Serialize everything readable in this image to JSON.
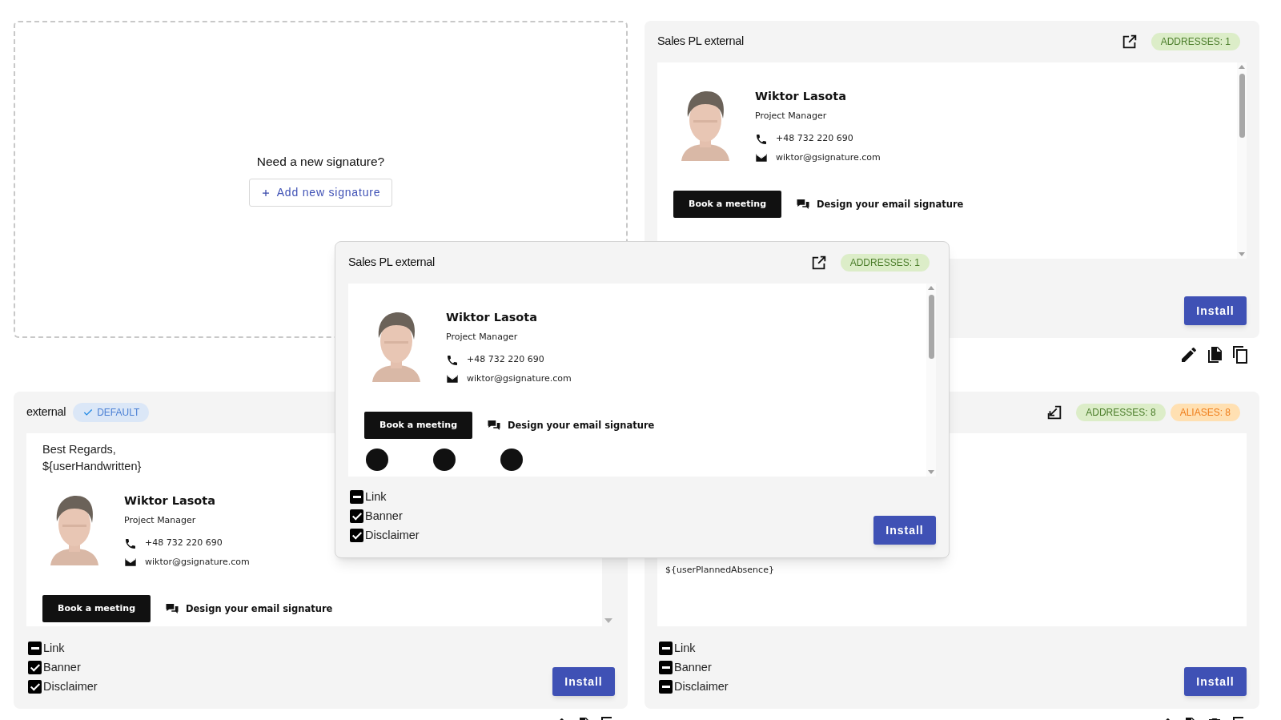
{
  "new_signature_card": {
    "prompt": "Need a new signature?",
    "button": "Add new signature"
  },
  "cards": [
    {
      "title": "Sales PL external",
      "badges": [
        {
          "text": "ADDRESSES: 1",
          "color": "#dcedc8"
        }
      ],
      "preview": {
        "kind": "signature",
        "name": "Wiktor Lasota",
        "role": "Project Manager",
        "phone": "+48 732 220 690",
        "email": "wiktor@gsignature.com",
        "meeting_button": "Book a meeting",
        "design_link": "Design your email signature"
      },
      "install": "Install"
    },
    {
      "title": "external",
      "default_chip": "DEFAULT",
      "preview": {
        "kind": "signature",
        "greeting": [
          "Best Regards,",
          "${userHandwritten}"
        ],
        "name": "Wiktor Lasota",
        "role": "Project Manager",
        "phone": "+48 732 220 690",
        "email": "wiktor@gsignature.com",
        "meeting_button": "Book a meeting",
        "design_link": "Design your email signature"
      },
      "options": [
        {
          "label": "Link",
          "checked": false,
          "indeterminate": true
        },
        {
          "label": "Banner",
          "checked": true
        },
        {
          "label": "Disclaimer",
          "checked": true
        }
      ],
      "install": "Install"
    },
    {
      "badges": [
        {
          "text": "ADDRESSES: 8",
          "color": "#dcedc8"
        },
        {
          "text": "ALIASES: 8",
          "color": "#ffe0b2"
        }
      ],
      "preview": {
        "kind": "text",
        "lines": [
          "${userPlannedAbsence}"
        ]
      },
      "options": [
        {
          "label": "Link",
          "checked": false,
          "indeterminate": true
        },
        {
          "label": "Banner",
          "checked": false,
          "indeterminate": true
        },
        {
          "label": "Disclaimer",
          "checked": false,
          "indeterminate": true
        }
      ],
      "install": "Install"
    }
  ],
  "dragged_card": {
    "title": "Sales PL external",
    "badges": [
      {
        "text": "ADDRESSES: 1",
        "color": "#dcedc8"
      }
    ],
    "preview": {
      "kind": "signature",
      "name": "Wiktor Lasota",
      "role": "Project Manager",
      "phone": "+48 732 220 690",
      "email": "wiktor@gsignature.com",
      "meeting_button": "Book a meeting",
      "design_link": "Design your email signature",
      "social": true
    },
    "options": [
      {
        "label": "Link",
        "checked": false,
        "indeterminate": true
      },
      {
        "label": "Banner",
        "checked": true
      },
      {
        "label": "Disclaimer",
        "checked": true
      }
    ],
    "install": "Install"
  }
}
